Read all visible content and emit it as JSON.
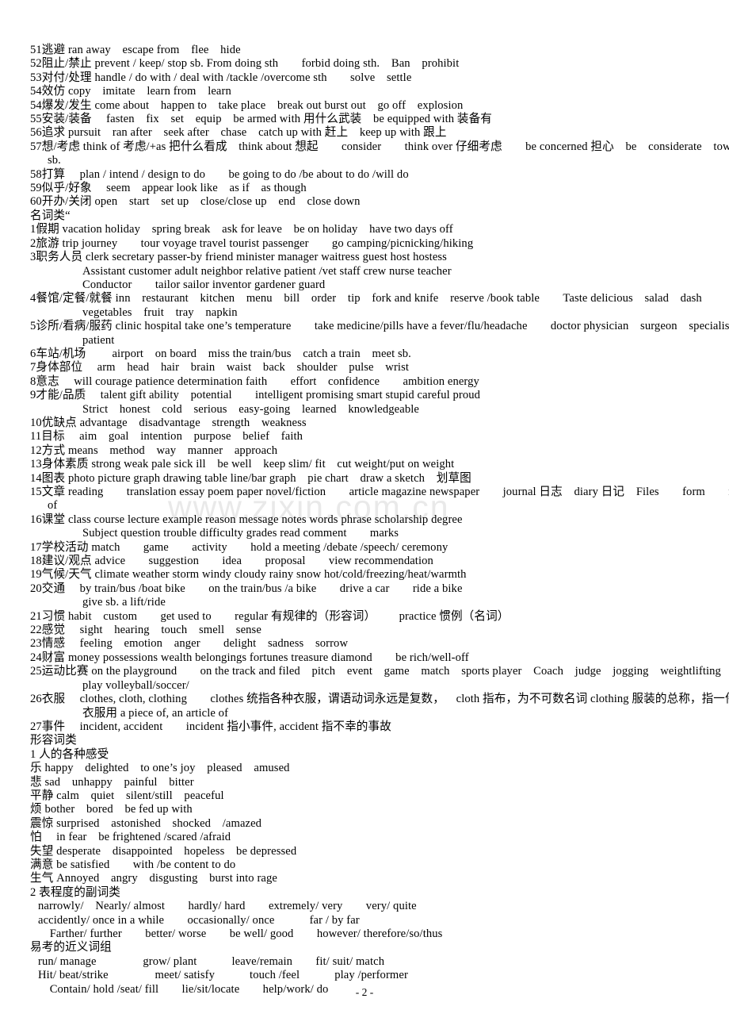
{
  "document": {
    "watermark": "www.zixin.com.cn",
    "footer": "- 2 -",
    "sections": [
      {
        "id": "verbs-continued",
        "heading": null,
        "entries": [
          {
            "num": "51",
            "cn": "逃避",
            "text": "ran away escape from flee hide",
            "subs": []
          },
          {
            "num": "52",
            "cn": "阻止/禁止",
            "text": "prevent / keep/ stop sb. From doing sth  forbid doing sth. Ban prohibit",
            "subs": []
          },
          {
            "num": "53",
            "cn": "对付/处理",
            "text": "handle / do with / deal with /tackle /overcome sth  solve settle",
            "subs": []
          },
          {
            "num": "54",
            "cn": "效仿",
            "text": "copy imitate learn from learn",
            "subs": []
          },
          {
            "num": "54",
            "cn": "爆发/发生",
            "text": "come about happen to take place break out burst out go off explosion",
            "subs": []
          },
          {
            "num": "55",
            "cn": "安装/装备",
            "text": " fasten fix set equip be armed with 用什么武装 be equipped with 装备有",
            "subs": []
          },
          {
            "num": "56",
            "cn": "追求",
            "text": "pursuit ran after seek after chase catch up with 赶上 keep up with 跟上",
            "subs": []
          },
          {
            "num": "57",
            "cn": "想/考虑",
            "text": "think of 考虑/+as 把什么看成 think about 想起  consider  think over 仔细考虑  be concerned 担心 be considerate towards",
            "subs": [
              "sb."
            ]
          },
          {
            "num": "58",
            "cn": "打算",
            "text": " plan / intend / design to do  be going to do /be about to do /will do",
            "subs": []
          },
          {
            "num": "59",
            "cn": "似乎/好象",
            "text": " seem appear look like as if as though",
            "subs": []
          },
          {
            "num": "60",
            "cn": "开办/关闭",
            "text": "open start set up close/close up end close down",
            "subs": []
          }
        ]
      },
      {
        "id": "nouns",
        "heading": "名词类“",
        "entries": [
          {
            "num": "1",
            "cn": "假期",
            "text": "vacation holiday spring break ask for leave be on holiday have two days off",
            "subs": []
          },
          {
            "num": "2",
            "cn": "旅游",
            "text": "trip journey  tour voyage travel tourist passenger  go camping/picnicking/hiking",
            "subs": []
          },
          {
            "num": "3",
            "cn": "职务人员",
            "text": "clerk secretary passer-by friend minister manager waitress guest host hostess",
            "subs": [
              "Assistant customer adult neighbor relative patient /vet staff crew nurse teacher",
              "Conductor  tailor sailor inventor gardener guard"
            ]
          },
          {
            "num": "4",
            "cn": "餐馆/定餐/就餐",
            "text": "inn restaurant kitchen menu bill order tip fork and knife reserve /book table  Taste delicious salad dash",
            "subs": [
              "vegetables fruit tray napkin"
            ]
          },
          {
            "num": "5",
            "cn": "诊所/看病/服药",
            "text": "clinic hospital take one’s temperature  take medicine/pills have a fever/flu/headache  doctor physician surgeon specialist",
            "subs": [
              "patient"
            ]
          },
          {
            "num": "6",
            "cn": "车站/机场",
            "text": "  airport on board miss the train/bus catch a train meet sb.",
            "subs": []
          },
          {
            "num": "7",
            "cn": "身体部位",
            "text": " arm head hair brain waist back shoulder pulse wrist",
            "subs": []
          },
          {
            "num": "8",
            "cn": "意志",
            "text": " will courage patience determination faith  effort confidence  ambition energy",
            "subs": []
          },
          {
            "num": "9",
            "cn": "才能/品质",
            "text": " talent gift ability potential  intelligent promising smart stupid careful proud",
            "subs": [
              "Strict honest cold serious easy-going learned knowledgeable"
            ]
          },
          {
            "num": "10",
            "cn": "优缺点",
            "text": "advantage disadvantage strength weakness",
            "subs": []
          },
          {
            "num": "11",
            "cn": "目标",
            "text": " aim goal intention purpose belief faith",
            "subs": []
          },
          {
            "num": "12",
            "cn": "方式",
            "text": "means method way manner approach",
            "subs": []
          },
          {
            "num": "13",
            "cn": "身体素质",
            "text": "strong weak pale sick ill be well keep slim/ fit cut weight/put on weight",
            "subs": []
          },
          {
            "num": "14",
            "cn": "图表",
            "text": "photo picture graph drawing table line/bar graph pie chart draw a sketch 划草图",
            "subs": []
          },
          {
            "num": "15",
            "cn": "文章",
            "text": "reading  translation essay poem paper novel/fiction  article magazine newspaper  journal 日志 diary 日记 Files  form  make a list",
            "subs": [
              "of"
            ]
          },
          {
            "num": "16",
            "cn": "课堂",
            "text": "class course lecture example reason message notes words phrase scholarship degree",
            "subs": [
              "Subject question trouble difficulty grades read comment  marks"
            ]
          },
          {
            "num": "17",
            "cn": "学校活动",
            "text": "match  game  activity  hold a meeting /debate /speech/ ceremony",
            "subs": []
          },
          {
            "num": "18",
            "cn": "建议/观点",
            "text": "advice  suggestion  idea  proposal  view recommendation",
            "subs": []
          },
          {
            "num": "19",
            "cn": "气候/天气",
            "text": "climate weather storm windy cloudy rainy snow hot/cold/freezing/heat/warmth",
            "subs": []
          },
          {
            "num": "20",
            "cn": "交通",
            "text": " by train/bus /boat bike  on the train/bus /a bike  drive a car  ride a bike",
            "subs": [
              "give sb. a lift/ride"
            ]
          },
          {
            "num": "21",
            "cn": "习惯",
            "text": "habit custom  get used to  regular 有规律的（形容词）  practice 惯例（名词）",
            "subs": []
          },
          {
            "num": "22",
            "cn": "感觉",
            "text": " sight hearing touch smell sense",
            "subs": []
          },
          {
            "num": "23",
            "cn": "情感",
            "text": " feeling emotion anger  delight sadness sorrow",
            "subs": []
          },
          {
            "num": "24",
            "cn": "财富",
            "text": "money possessions wealth belongings fortunes treasure diamond  be rich/well-off",
            "subs": []
          },
          {
            "num": "25",
            "cn": "运动比赛",
            "text": "on the playground  on the track and filed pitch event game match sports player Coach judge jogging weightlifting",
            "subs": [
              "play volleyball/soccer/"
            ]
          },
          {
            "num": "26",
            "cn": "衣服",
            "text": " clothes, cloth, clothing  clothes 统指各种衣服，谓语动词永远是复数， cloth 指布，为不可数名词 clothing 服装的总称，指一件",
            "subs": [
              "衣服用 a piece of, an article of"
            ]
          },
          {
            "num": "27",
            "cn": "事件",
            "text": " incident, accident  incident 指小事件, accident 指不幸的事故",
            "subs": []
          }
        ]
      },
      {
        "id": "adjectives",
        "heading": "形容词类",
        "subheading": "1 人的各种感受",
        "feelings": [
          {
            "cn": "乐",
            "text": "happy delighted to one’s joy pleased amused"
          },
          {
            "cn": "悲",
            "text": "sad unhappy painful bitter"
          },
          {
            "cn": "平静",
            "text": "calm quiet silent/still peaceful"
          },
          {
            "cn": "烦",
            "text": "bother bored be fed up with"
          },
          {
            "cn": "震惊",
            "text": "surprised astonished shocked /amazed"
          },
          {
            "cn": "怕",
            "text": " in fear be frightened /scared /afraid"
          },
          {
            "cn": "失望",
            "text": "desperate disappointed hopeless be depressed"
          },
          {
            "cn": "满意",
            "text": "be satisfied  with /be content to do"
          },
          {
            "cn": "生气",
            "text": "Annoyed angry disgusting burst into rage"
          }
        ]
      },
      {
        "id": "adverbs",
        "heading": "2 表程度的副词类",
        "lines": [
          "narrowly/ Nearly/ almost  hardly/ hard  extremely/ very  very/ quite",
          "accidently/ once in a while  occasionally/ once   far / by far",
          " Farther/ further  better/ worse  be well/ good  however/ therefore/so/thus"
        ]
      },
      {
        "id": "synonym-groups",
        "heading": "易考的近义词组",
        "lines": [
          "run/ manage    grow/ plant   leave/remain  fit/ suit/ match",
          "Hit/ beat/strike    meet/ satisfy   touch /feel   play /performer",
          " Contain/ hold /seat/ fill  lie/sit/locate  help/work/ do"
        ]
      }
    ]
  }
}
